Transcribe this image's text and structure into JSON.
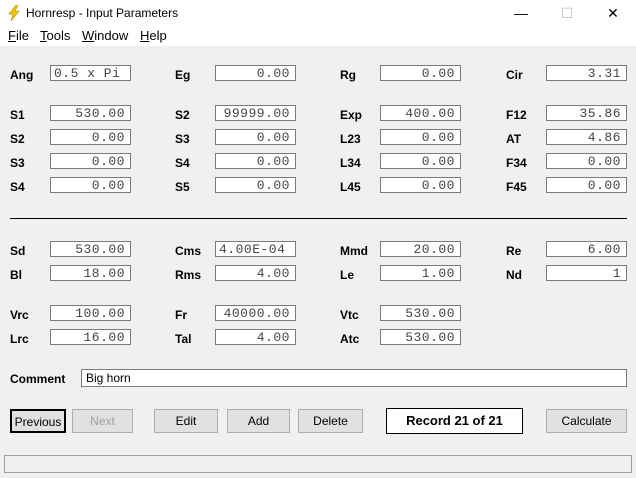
{
  "window": {
    "title": "Hornresp - Input Parameters",
    "minimize": "—",
    "maximize": "☐",
    "close": "✕"
  },
  "menu": [
    {
      "label": "File",
      "underline": "F",
      "rest": "ile"
    },
    {
      "label": "Tools",
      "underline": "T",
      "rest": "ools"
    },
    {
      "label": "Window",
      "underline": "W",
      "rest": "indow"
    },
    {
      "label": "Help",
      "underline": "H",
      "rest": "elp"
    }
  ],
  "params": {
    "ang": {
      "label": "Ang",
      "value": "0.5 x Pi"
    },
    "eg": {
      "label": "Eg",
      "value": "0.00"
    },
    "rg": {
      "label": "Rg",
      "value": "0.00"
    },
    "cir": {
      "label": "Cir",
      "value": "3.31"
    },
    "s1": {
      "label": "S1",
      "value": "530.00"
    },
    "s2a": {
      "label": "S2",
      "value": "99999.00"
    },
    "exp": {
      "label": "Exp",
      "value": "400.00"
    },
    "f12": {
      "label": "F12",
      "value": "35.86"
    },
    "s2b": {
      "label": "S2",
      "value": "0.00"
    },
    "s3a": {
      "label": "S3",
      "value": "0.00"
    },
    "l23": {
      "label": "L23",
      "value": "0.00"
    },
    "at": {
      "label": "AT",
      "value": "4.86"
    },
    "s3b": {
      "label": "S3",
      "value": "0.00"
    },
    "s4a": {
      "label": "S4",
      "value": "0.00"
    },
    "l34": {
      "label": "L34",
      "value": "0.00"
    },
    "f34": {
      "label": "F34",
      "value": "0.00"
    },
    "s4b": {
      "label": "S4",
      "value": "0.00"
    },
    "s5": {
      "label": "S5",
      "value": "0.00"
    },
    "l45": {
      "label": "L45",
      "value": "0.00"
    },
    "f45": {
      "label": "F45",
      "value": "0.00"
    },
    "sd": {
      "label": "Sd",
      "value": "530.00"
    },
    "cms": {
      "label": "Cms",
      "value": "4.00E-04"
    },
    "mmd": {
      "label": "Mmd",
      "value": "20.00"
    },
    "re": {
      "label": "Re",
      "value": "6.00"
    },
    "bl": {
      "label": "Bl",
      "value": "18.00"
    },
    "rms": {
      "label": "Rms",
      "value": "4.00"
    },
    "le": {
      "label": "Le",
      "value": "1.00"
    },
    "nd": {
      "label": "Nd",
      "value": "1"
    },
    "vrc": {
      "label": "Vrc",
      "value": "100.00"
    },
    "fr": {
      "label": "Fr",
      "value": "40000.00"
    },
    "vtc": {
      "label": "Vtc",
      "value": "530.00"
    },
    "lrc": {
      "label": "Lrc",
      "value": "16.00"
    },
    "tal": {
      "label": "Tal",
      "value": "4.00"
    },
    "atc": {
      "label": "Atc",
      "value": "530.00"
    }
  },
  "comment": {
    "label": "Comment",
    "value": "Big horn"
  },
  "buttons": {
    "previous": "Previous",
    "next": "Next",
    "edit": "Edit",
    "add": "Add",
    "delete": "Delete",
    "calculate": "Calculate"
  },
  "record": "Record 21 of 21",
  "colors": {
    "icon": "#f5c400",
    "field_border": "#7a7a7a",
    "background": "#f0f0f0"
  },
  "icons": {
    "app": "lightning-bolt-icon"
  }
}
